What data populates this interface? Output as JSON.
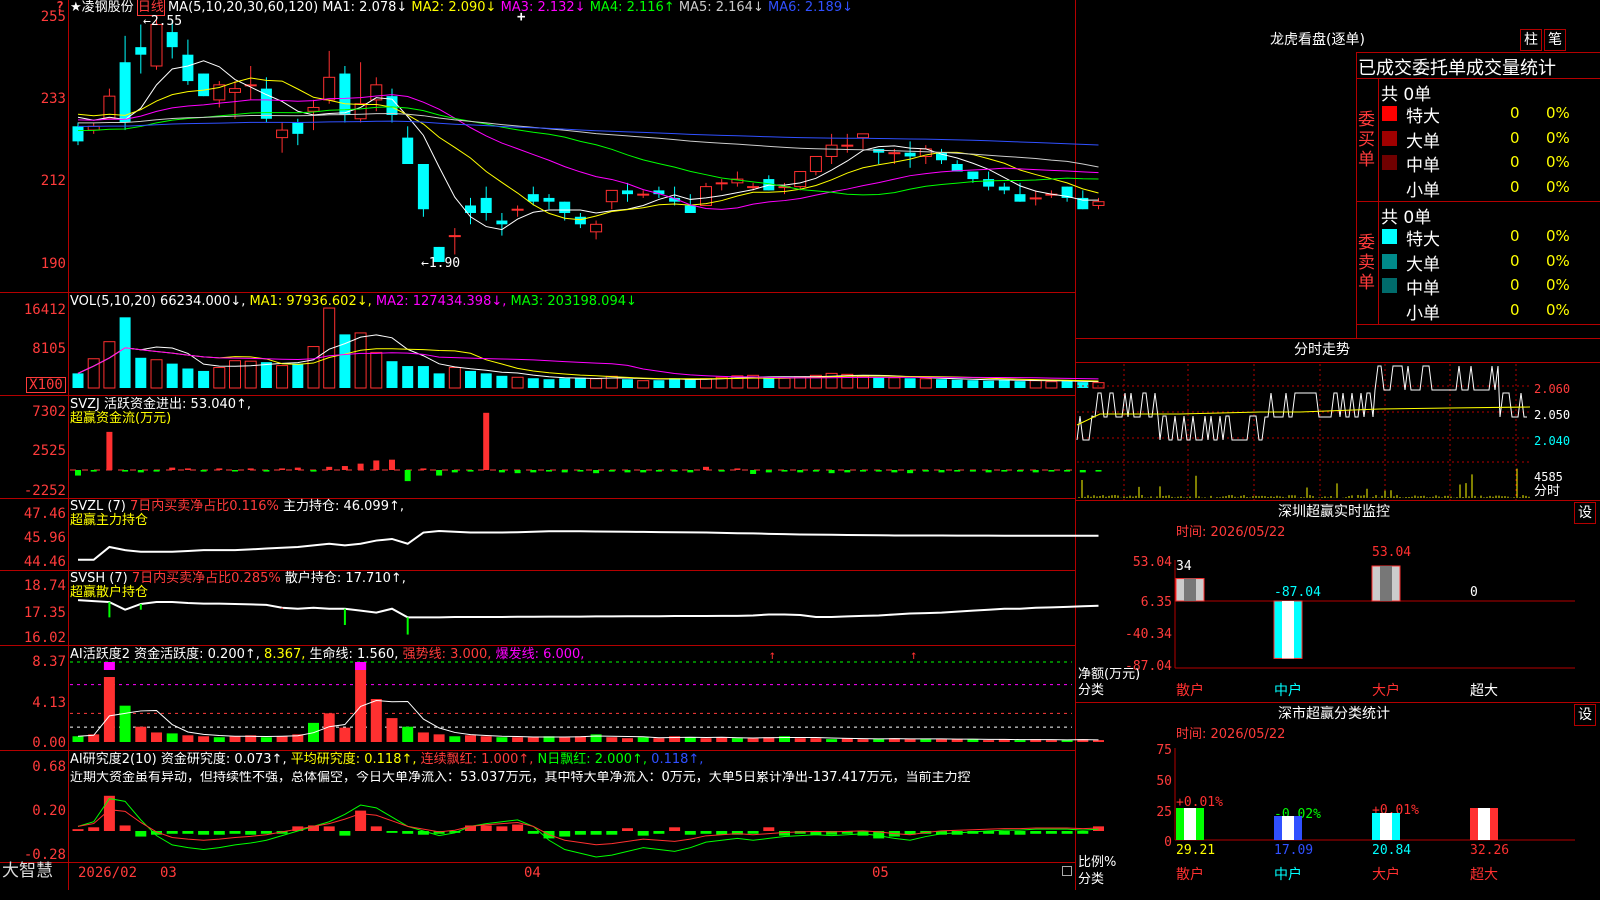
{
  "stock": {
    "star": "★",
    "name": "凌钢股份",
    "period": "日线",
    "ma_label": "MA(5,10,20,30,60,120)",
    "ma_values": [
      {
        "text": "MA1: 2.078↓",
        "color": "#ffffff"
      },
      {
        "text": "MA2: 2.090↓",
        "color": "#ffff00"
      },
      {
        "text": "MA3: 2.132↓",
        "color": "#ff00ff"
      },
      {
        "text": "MA4: 2.116↑",
        "color": "#00ff00"
      },
      {
        "text": "MA5: 2.164↓",
        "color": "#cccccc"
      },
      {
        "text": "MA6: 2.189↓",
        "color": "#3050ff"
      }
    ],
    "high_marker": "←2.55",
    "low_marker": "←1.90",
    "cross": "+",
    "help": "?"
  },
  "axes": {
    "price": [
      "255",
      "233",
      "212",
      "190"
    ],
    "vol": [
      "16412",
      "8105",
      "X100"
    ],
    "svzj": [
      "7302",
      "2525",
      "-2252"
    ],
    "svzl": [
      "47.46",
      "45.96",
      "44.46"
    ],
    "svsh": [
      "18.74",
      "17.35",
      "16.02"
    ],
    "ai1": [
      "8.37",
      "4.13",
      "0.00"
    ],
    "ai2": [
      "0.68",
      "0.20",
      "-0.28"
    ]
  },
  "panels": {
    "vol": {
      "prefix": "VOL(5,10,20)",
      "value": "66234.000↓,",
      "ma1": "MA1: 97936.602↓,",
      "ma2": "MA2: 127434.398↓,",
      "ma3": "MA3: 203198.094↓"
    },
    "svzj": {
      "prefix": "SVZJ",
      "text": "活跃资金进出: 53.040↑,",
      "sub": "超赢资金流(万元)"
    },
    "svzl": {
      "prefix": "SVZL (7)",
      "red": "7日内买卖净占比0.116%",
      "text": "主力持仓: 46.099↑,",
      "sub": "超赢主力持仓"
    },
    "svsh": {
      "prefix": "SVSH (7)",
      "red": "7日内买卖净占比0.285%",
      "text": "散户持仓: 17.710↑,",
      "sub": "超赢散户持仓"
    },
    "ai1": {
      "prefix": "AI活跃度2",
      "t1": "资金活跃度: 0.200↑,",
      "t2": "8.367,",
      "t3": "生命线: 1.560,",
      "t4": "强势线: 3.000,",
      "t5": "爆发线: 6.000,"
    },
    "ai2": {
      "prefix": "AI研究度2(10)",
      "t1": "资金研究度: 0.073↑,",
      "t2": "平均研究度: 0.118↑,",
      "t3": "连续飘红: 1.000↑,",
      "t4": "N日飘红: 2.000↑,",
      "t5": "0.118↑,",
      "note": "近期大资金虽有异动，但持续性不强，总体偏空，今日大单净流入：53.037万元，其中特大单净流入：0万元，大单5日累计净出-137.417万元，当前主力控"
    }
  },
  "bottom": {
    "brand": "大智慧",
    "dates": [
      "2026/02",
      "03",
      "04",
      "05"
    ]
  },
  "right": {
    "title": "龙虎看盘(逐单)",
    "btn1": "柱",
    "btn2": "笔",
    "subtitle": "已成交委托单成交量统计",
    "buy": {
      "side": "委买单",
      "total": "共 0单",
      "rows": [
        {
          "name": "特大",
          "n": "0",
          "p": "0%",
          "c": "#ff0000"
        },
        {
          "name": "大单",
          "n": "0",
          "p": "0%",
          "c": "#a00000"
        },
        {
          "name": "中单",
          "n": "0",
          "p": "0%",
          "c": "#700000"
        },
        {
          "name": "小单",
          "n": "0",
          "p": "0%",
          "c": "#000000"
        }
      ]
    },
    "sell": {
      "side": "委卖单",
      "total": "共 0单",
      "rows": [
        {
          "name": "特大",
          "n": "0",
          "p": "0%",
          "c": "#00ffff"
        },
        {
          "name": "大单",
          "n": "0",
          "p": "0%",
          "c": "#008b8b"
        },
        {
          "name": "中单",
          "n": "0",
          "p": "0%",
          "c": "#006b6b"
        },
        {
          "name": "小单",
          "n": "0",
          "p": "0%",
          "c": "#000000"
        }
      ]
    },
    "intraday": {
      "title": "分时走势",
      "prices": [
        "2.060",
        "2.050",
        "2.040"
      ],
      "vol": "4585",
      "unit": "分时"
    },
    "monitor": {
      "title": "深圳超赢实时监控",
      "btn": "设",
      "time": "时间: 2026/05/22",
      "axis": [
        "53.04",
        "6.35",
        "-40.34",
        "-87.04"
      ],
      "ylabel1": "净额(万元)",
      "ylabel2": "分类",
      "cats": [
        "散户",
        "中户",
        "大户",
        "超大"
      ],
      "vals": [
        "34",
        "-87.04",
        "53.04",
        "0"
      ]
    },
    "classify": {
      "title": "深市超赢分类统计",
      "btn": "设",
      "time": "时间: 2026/05/22",
      "axis": [
        "75",
        "50",
        "25",
        "0"
      ],
      "ylabel1": "比例%",
      "ylabel2": "分类",
      "cats": [
        "散户",
        "中户",
        "大户",
        "超大"
      ],
      "chg": [
        "+0.01%",
        "-0.02%",
        "+0.01%",
        ""
      ],
      "vals": [
        "29.21",
        "17.09",
        "20.84",
        "32.26"
      ]
    }
  }
}
